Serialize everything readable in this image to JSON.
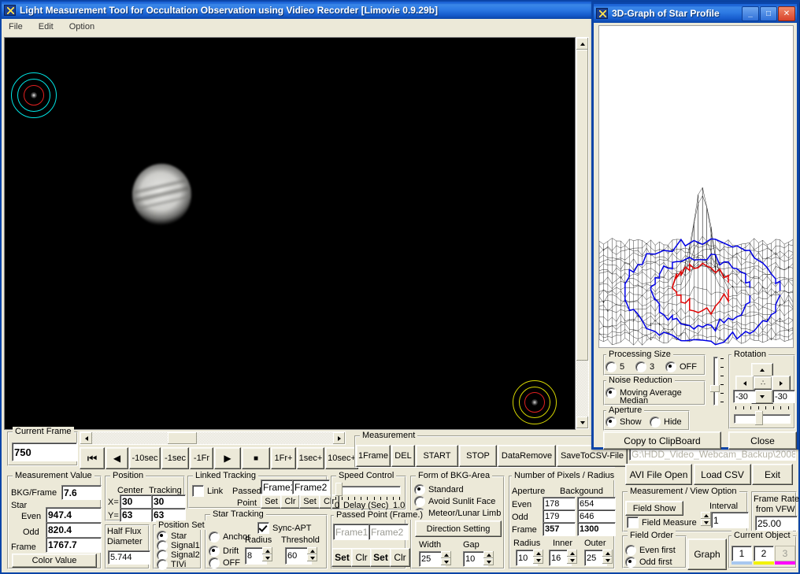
{
  "main_window": {
    "title": "Light Measurement Tool for Occultation Observation using Vidieo Recorder [Limovie 0.9.29b]",
    "menu": [
      "File",
      "Edit",
      "Option"
    ]
  },
  "transport": {
    "current_frame_label": "Current Frame",
    "current_frame_value": "750",
    "buttons": [
      "⏮",
      "◀",
      "-10sec",
      "-1sec",
      "-1Fr",
      "▶",
      "■",
      "1Fr+",
      "1sec+",
      "10sec+"
    ]
  },
  "measurement_panel": {
    "label": "Measurement",
    "buttons": [
      "1Frame",
      "DEL",
      "START",
      "STOP",
      "DataRemove",
      "SaveToCSV-File"
    ]
  },
  "measurement_value": {
    "label": "Measurement Value",
    "bkg_label": "BKG/Frame",
    "bkg_value": "7.6",
    "star_label": "Star",
    "even_label": "Even",
    "even_value": "947.4",
    "odd_label": "Odd",
    "odd_value": "820.4",
    "frame_label": "Frame",
    "frame_value": "1767.7",
    "color_value_button": "Color Value"
  },
  "position": {
    "label": "Position",
    "col_center": "Center",
    "col_tracking": "Tracking",
    "x_label": "X=",
    "y_label": "Y=",
    "x_center": "30",
    "x_tracking": "30",
    "y_center": "63",
    "y_tracking": "63"
  },
  "half_flux": {
    "label": "Half Flux",
    "label2": "Diameter",
    "value": "5.744"
  },
  "position_set": {
    "label": "Position Set",
    "options": [
      "Star",
      "Signal1",
      "Signal2",
      "TIVi"
    ],
    "selected": "Star"
  },
  "linked_tracking": {
    "label": "Linked Tracking",
    "link_checkbox": "Link",
    "link_checked": false,
    "passed_label": "Passed-",
    "point_label": "Point",
    "frame1": "Frame1",
    "frame2": "Frame2",
    "set1": "Set",
    "clr1": "Clr",
    "set2": "Set",
    "clr2": "Clr"
  },
  "star_tracking": {
    "label": "Star Tracking",
    "sync_apt": "Sync-APT",
    "sync_apt_checked": true,
    "options": [
      "Anchor",
      "Drift",
      "OFF"
    ],
    "selected": "Drift",
    "radius_label": "Radius",
    "radius_value": "8",
    "threshold_label": "Threshold",
    "threshold_value": "60"
  },
  "speed_control": {
    "label": "Speed Control",
    "min": "0",
    "delay_label": "Delay (Sec)",
    "max": "1.0"
  },
  "passed_point": {
    "label": "Passed Point (Frame.)",
    "frame1": "Frame1",
    "frame2": "Frame2",
    "buttons": [
      "Set",
      "Clr",
      "Set",
      "Clr"
    ]
  },
  "bkg_area": {
    "label": "Form of BKG-Area",
    "options": [
      "Standard",
      "Avoid Sunlit Face",
      "Meteor/Lunar Limb"
    ],
    "selected": "Standard",
    "direction_button": "Direction Setting",
    "width_label": "Width",
    "width_value": "25",
    "gap_label": "Gap",
    "gap_value": "10"
  },
  "pixels_radius": {
    "label": "Number of Pixels / Radius",
    "col_aperture": "Aperture",
    "col_background": "Backgound",
    "rows": [
      {
        "name": "Even",
        "aperture": "178",
        "background": "654"
      },
      {
        "name": "Odd",
        "aperture": "179",
        "background": "646"
      },
      {
        "name": "Frame",
        "aperture": "357",
        "background": "1300"
      }
    ],
    "radius_label": "Radius",
    "radius_value": "10",
    "inner_label": "Inner",
    "inner_value": "16",
    "outer_label": "Outer",
    "outer_value": "25"
  },
  "file_panel": {
    "path_value": "G:\\HDD_Video_Webcam_Backup\\2008",
    "avi_open": "AVI File Open",
    "load_csv": "Load CSV",
    "exit": "Exit"
  },
  "view_option": {
    "label": "Measurement / View Option",
    "field_show": "Field Show",
    "field_measure": "Field Measure",
    "field_measure_checked": false,
    "interval_label": "Interval",
    "interval_value": "1"
  },
  "frame_rate": {
    "label1": "Frame Rate",
    "label2": "from VFW",
    "value": "25.00"
  },
  "field_order": {
    "label": "Field Order",
    "options": [
      "Even first",
      "Odd first"
    ],
    "selected": "Odd first"
  },
  "graph_button": "Graph",
  "current_object": {
    "label": "Current Object",
    "items": [
      {
        "label": "1",
        "color": "#a8c8f0",
        "enabled": true
      },
      {
        "label": "2",
        "color": "#f2f200",
        "enabled": true
      },
      {
        "label": "3",
        "color": "#ff00ff",
        "enabled": false
      }
    ],
    "selected": "1"
  },
  "graph_window": {
    "title": "3D-Graph of Star Profile",
    "minimize": "_",
    "maximize": "□",
    "close": "✕",
    "processing_size": {
      "label": "Processing Size",
      "options": [
        "5",
        "3",
        "OFF"
      ],
      "selected": "OFF"
    },
    "noise_reduction": {
      "label": "Noise Reduction",
      "options": [
        "Moving Average",
        "Median"
      ],
      "selected": "Moving Average"
    },
    "aperture": {
      "label": "Aperture",
      "options": [
        "Show",
        "Hide"
      ],
      "selected": "Show"
    },
    "rotation": {
      "label": "Rotation",
      "center_button": "∴",
      "left_value": "-30",
      "right_value": "-30"
    },
    "copy_clipboard": "Copy to ClipBoard",
    "close_button": "Close"
  },
  "video": {
    "markers": [
      {
        "name": "tracking-marker-star",
        "color": "#00e5e5",
        "inner_color": "#e02020"
      },
      {
        "name": "tracking-marker-comparison",
        "color": "#d8d800",
        "inner_color": "#e02020"
      }
    ],
    "object_dots": [
      {
        "color": "#ff00ff"
      },
      {
        "color": "#00e000"
      }
    ]
  }
}
